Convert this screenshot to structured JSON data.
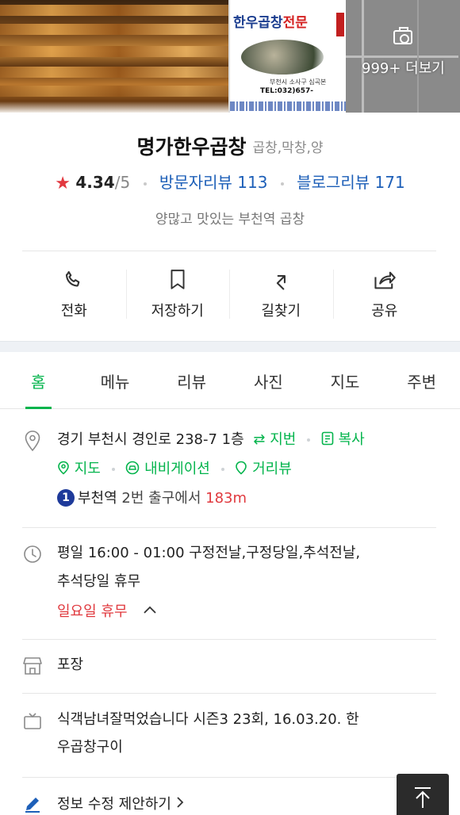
{
  "photos": {
    "sign_title_a": "한우곱창",
    "sign_title_b": "전문",
    "sign_address": "부천시 소사구 심곡본",
    "sign_tel": "TEL:032)657-",
    "more_label": "999+ 더보기"
  },
  "place": {
    "name": "명가한우곱창",
    "category": "곱창,막창,양",
    "rating": "4.34",
    "rating_max": "/5",
    "visitor_reviews": "방문자리뷰 113",
    "blog_reviews": "블로그리뷰 171",
    "tagline": "양많고 맛있는 부천역 곱창"
  },
  "actions": [
    {
      "label": "전화",
      "icon": "phone-icon"
    },
    {
      "label": "저장하기",
      "icon": "bookmark-icon"
    },
    {
      "label": "길찾기",
      "icon": "directions-icon"
    },
    {
      "label": "공유",
      "icon": "share-icon"
    }
  ],
  "tabs": [
    "홈",
    "메뉴",
    "리뷰",
    "사진",
    "지도",
    "주변"
  ],
  "address": {
    "text": "경기 부천시 경인로 238-7 1층",
    "jibun": "지번",
    "copy": "복사",
    "map": "지도",
    "navigation": "내비게이션",
    "street_view": "거리뷰",
    "subway_line": "1",
    "station": "부천역",
    "exit": "2번 출구에서",
    "distance": "183m"
  },
  "hours": {
    "line1": "평일 16:00 - 01:00 구정전날,구정당일,추석전날,",
    "line2": "추석당일 휴무",
    "closed": "일요일 휴무"
  },
  "takeout": "포장",
  "tv": {
    "line1": "식객남녀잘먹었습니다 시즌3 23회, 16.03.20. 한",
    "line2": "우곱창구이"
  },
  "edit_suggestion": "정보 수정 제안하기",
  "colors": {
    "accent_green": "#03b44c",
    "link_blue": "#1d5fb8",
    "star_red": "#e2383f",
    "subway_line1": "#1e3a9a"
  }
}
